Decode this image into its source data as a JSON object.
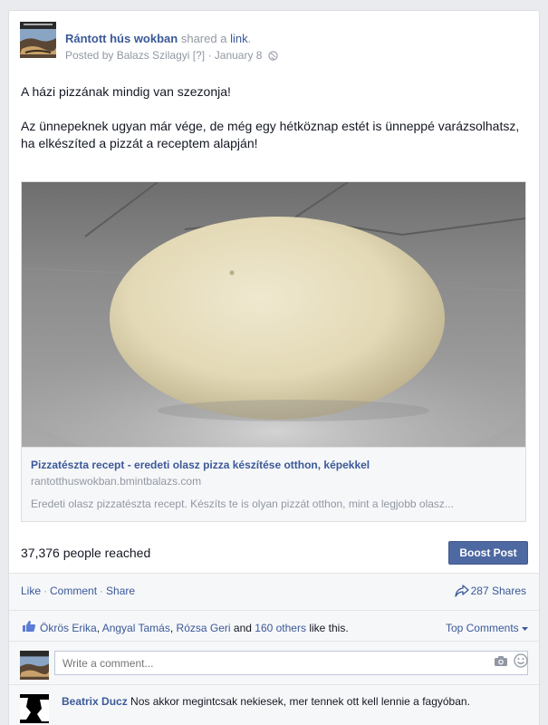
{
  "post": {
    "page_name": "Rántott hús wokban",
    "shared_text": "shared a",
    "link_word": "link",
    "period": ".",
    "posted_by_prefix": "Posted by Balazs Szilagyi",
    "posted_by_help": "[?]",
    "date_separator": "·",
    "date": "January 8",
    "message_paragraphs": [
      "A házi pizzának mindig van szezonja!",
      "Az ünnepeknek ugyan már vége, de még egy hétköznap estét is ünneppé varázsolhatsz, ha elkészíted a pizzát a receptem alapján!"
    ]
  },
  "link_card": {
    "title": "Pizzatészta recept - eredeti olasz pizza készítése otthon, képekkel",
    "domain": "rantotthuswokban.bmintbalazs.com",
    "description": "Eredeti olasz pizzatészta recept. Készíts te is olyan pizzát otthon, mint a legjobb olasz..."
  },
  "stats": {
    "reach": "37,376 people reached",
    "boost_label": "Boost Post"
  },
  "actions": {
    "like": "Like",
    "comment": "Comment",
    "share": "Share",
    "separator": "·",
    "shares_count": "287 Shares"
  },
  "likes": {
    "name1": "Ökrös Erika",
    "sep1": ", ",
    "name2": "Angyal Tamás",
    "sep2": ", ",
    "name3": "Rózsa Geri",
    "and": " and ",
    "others": "160 others",
    "tail": " like this.",
    "top_comments": "Top Comments"
  },
  "comment_box": {
    "placeholder": "Write a comment..."
  },
  "comments": [
    {
      "author": "Beatrix Ducz",
      "text": " Nos akkor megintcsak nekiesek, mer tennek ott kell lennie a fagyóban."
    }
  ],
  "colors": {
    "link_blue": "#3b5998",
    "boost_blue": "#4e69a2",
    "muted_gray": "#9197a3",
    "card_background": "#f6f7f9"
  }
}
